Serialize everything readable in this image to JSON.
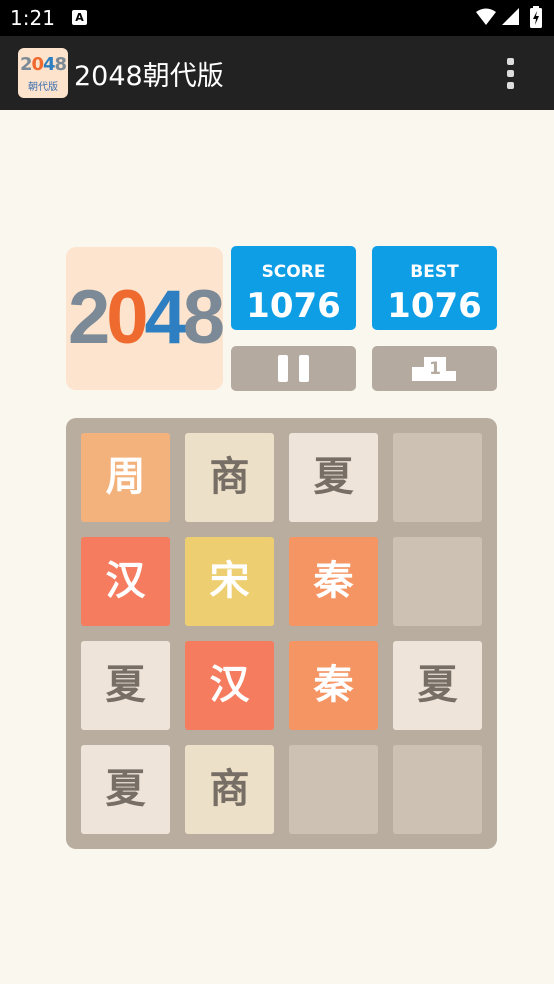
{
  "status": {
    "time": "1:21",
    "notif_icon": "A"
  },
  "app": {
    "title": "2048朝代版",
    "logo": {
      "digits": [
        "2",
        "0",
        "4",
        "8"
      ],
      "sub": "朝代版"
    }
  },
  "game": {
    "logo": {
      "digits": [
        "2",
        "0",
        "4",
        "8"
      ],
      "colors": [
        "#7b8a96",
        "#ef6a2f",
        "#2d7fc2",
        "#7b8a96"
      ]
    },
    "score": {
      "label": "SCORE",
      "value": "1076"
    },
    "best": {
      "label": "BEST",
      "value": "1076"
    },
    "pause_label": "pause",
    "leaderboard_label": "1",
    "tiles": [
      {
        "text": "周",
        "bg": "#f3b17c",
        "color": "#ffffff"
      },
      {
        "text": "商",
        "bg": "#ede0c8",
        "color": "#776e65"
      },
      {
        "text": "夏",
        "bg": "#eee4da",
        "color": "#776e65"
      },
      {
        "text": "",
        "bg": "#cdc1b4",
        "color": "#776e65"
      },
      {
        "text": "汉",
        "bg": "#f57c5f",
        "color": "#ffffff"
      },
      {
        "text": "宋",
        "bg": "#edcf72",
        "color": "#ffffff"
      },
      {
        "text": "秦",
        "bg": "#f59563",
        "color": "#ffffff"
      },
      {
        "text": "",
        "bg": "#cdc1b4",
        "color": "#776e65"
      },
      {
        "text": "夏",
        "bg": "#eee4da",
        "color": "#776e65"
      },
      {
        "text": "汉",
        "bg": "#f57c5f",
        "color": "#ffffff"
      },
      {
        "text": "秦",
        "bg": "#f59563",
        "color": "#ffffff"
      },
      {
        "text": "夏",
        "bg": "#eee4da",
        "color": "#776e65"
      },
      {
        "text": "夏",
        "bg": "#eee4da",
        "color": "#776e65"
      },
      {
        "text": "商",
        "bg": "#ede0c8",
        "color": "#776e65"
      },
      {
        "text": "",
        "bg": "#cdc1b4",
        "color": "#776e65"
      },
      {
        "text": "",
        "bg": "#cdc1b4",
        "color": "#776e65"
      }
    ]
  }
}
